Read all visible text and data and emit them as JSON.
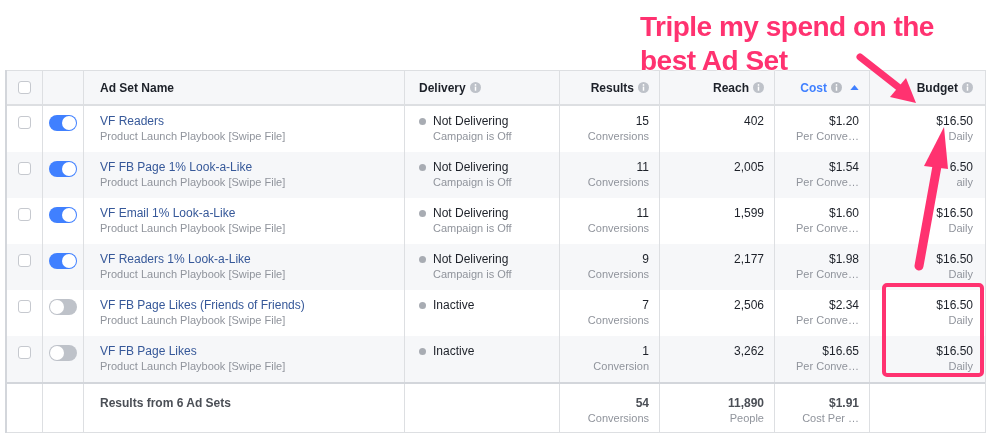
{
  "annotation": {
    "text": "Triple my spend on the best Ad Set"
  },
  "columns": [
    {
      "label": "Ad Set Name",
      "info": false,
      "sorted": false
    },
    {
      "label": "Delivery",
      "info": true,
      "sorted": false
    },
    {
      "label": "Results",
      "info": true,
      "sorted": false
    },
    {
      "label": "Reach",
      "info": true,
      "sorted": false
    },
    {
      "label": "Cost",
      "info": true,
      "sorted": true
    },
    {
      "label": "Budget",
      "info": true,
      "sorted": false
    }
  ],
  "header_checkbox": {
    "checked": false
  },
  "rows": [
    {
      "checked": false,
      "on": true,
      "name": "VF Readers",
      "campaign": "Product Launch Playbook [Swipe File]",
      "delivery": "Not Delivering",
      "delivery_detail": "Campaign is Off",
      "results": "15",
      "results_unit": "Conversions",
      "reach": "402",
      "cost": "$1.20",
      "cost_unit": "Per Conve…",
      "budget": "$16.50",
      "budget_unit": "Daily"
    },
    {
      "checked": false,
      "on": true,
      "name": "VF FB Page 1% Look-a-Like",
      "campaign": "Product Launch Playbook [Swipe File]",
      "delivery": "Not Delivering",
      "delivery_detail": "Campaign is Off",
      "results": "11",
      "results_unit": "Conversions",
      "reach": "2,005",
      "cost": "$1.54",
      "cost_unit": "Per Conve…",
      "budget": "6.50",
      "budget_unit": "aily"
    },
    {
      "checked": false,
      "on": true,
      "name": "VF Email 1% Look-a-Like",
      "campaign": "Product Launch Playbook [Swipe File]",
      "delivery": "Not Delivering",
      "delivery_detail": "Campaign is Off",
      "results": "11",
      "results_unit": "Conversions",
      "reach": "1,599",
      "cost": "$1.60",
      "cost_unit": "Per Conve…",
      "budget": "$16.50",
      "budget_unit": "Daily"
    },
    {
      "checked": false,
      "on": true,
      "name": "VF Readers 1% Look-a-Like",
      "campaign": "Product Launch Playbook [Swipe File]",
      "delivery": "Not Delivering",
      "delivery_detail": "Campaign is Off",
      "results": "9",
      "results_unit": "Conversions",
      "reach": "2,177",
      "cost": "$1.98",
      "cost_unit": "Per Conve…",
      "budget": "$16.50",
      "budget_unit": "Daily"
    },
    {
      "checked": false,
      "on": false,
      "name": "VF FB Page Likes (Friends of Friends)",
      "campaign": "Product Launch Playbook [Swipe File]",
      "delivery": "Inactive",
      "results": "7",
      "results_unit": "Conversions",
      "reach": "2,506",
      "cost": "$2.34",
      "cost_unit": "Per Conve…",
      "budget": "$16.50",
      "budget_unit": "Daily"
    },
    {
      "checked": false,
      "on": false,
      "name": "VF FB Page Likes",
      "campaign": "Product Launch Playbook [Swipe File]",
      "delivery": "Inactive",
      "results": "1",
      "results_unit": "Conversion",
      "reach": "3,262",
      "cost": "$16.65",
      "cost_unit": "Per Conve…",
      "budget": "$16.50",
      "budget_unit": "Daily"
    }
  ],
  "totals": {
    "label": "Results from 6 Ad Sets",
    "results": "54",
    "results_unit": "Conversions",
    "reach": "11,890",
    "reach_unit": "People",
    "cost": "$1.91",
    "cost_unit": "Cost Per …"
  }
}
